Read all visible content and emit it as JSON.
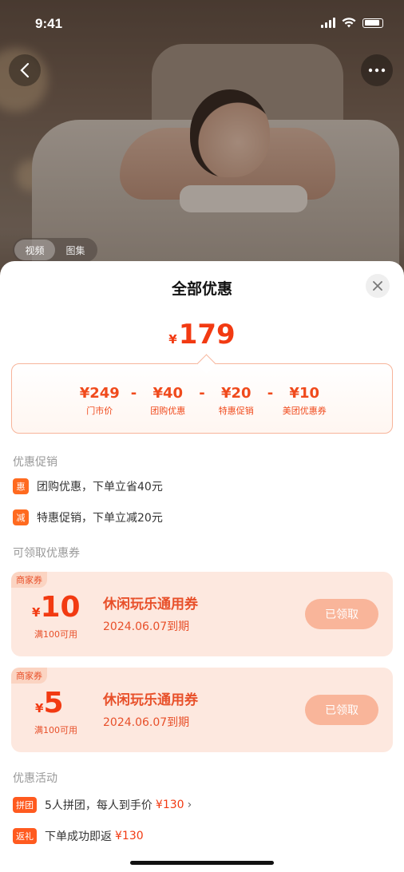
{
  "status_bar": {
    "time": "9:41"
  },
  "hero": {
    "media_tabs": [
      {
        "label": "视频",
        "selected": true
      },
      {
        "label": "图集",
        "selected": false
      }
    ]
  },
  "sheet": {
    "title": "全部优惠",
    "final_price": {
      "currency": "¥",
      "amount": "179"
    },
    "breakdown": {
      "items": [
        {
          "value": "¥249",
          "label": "门市价"
        },
        {
          "value": "¥40",
          "label": "团购优惠"
        },
        {
          "value": "¥20",
          "label": "特惠促销"
        },
        {
          "value": "¥10",
          "label": "美团优惠券"
        }
      ],
      "operator": "-"
    },
    "promotions": {
      "title": "优惠促销",
      "items": [
        {
          "tag": "惠",
          "text": "团购优惠，下单立省40元"
        },
        {
          "tag": "减",
          "text": "特惠促销，下单立减20元"
        }
      ]
    },
    "coupons": {
      "title": "可领取优惠券",
      "items": [
        {
          "tag": "商家券",
          "currency": "¥",
          "amount": "10",
          "condition": "满100可用",
          "name": "休闲玩乐通用券",
          "expiry": "2024.06.07到期",
          "button": "已领取"
        },
        {
          "tag": "商家券",
          "currency": "¥",
          "amount": "5",
          "condition": "满100可用",
          "name": "休闲玩乐通用券",
          "expiry": "2024.06.07到期",
          "button": "已领取"
        }
      ]
    },
    "activities": {
      "title": "优惠活动",
      "items": [
        {
          "tag": "拼团",
          "text": "5人拼团，每人到手价",
          "price": "¥130",
          "chevron": "›"
        },
        {
          "tag": "返礼",
          "text": "下单成功即返",
          "price": "¥130"
        }
      ]
    }
  },
  "colors": {
    "accent": "#f23a12",
    "coupon_bg": "#fde8df",
    "button_disabled": "#f9b59a"
  }
}
